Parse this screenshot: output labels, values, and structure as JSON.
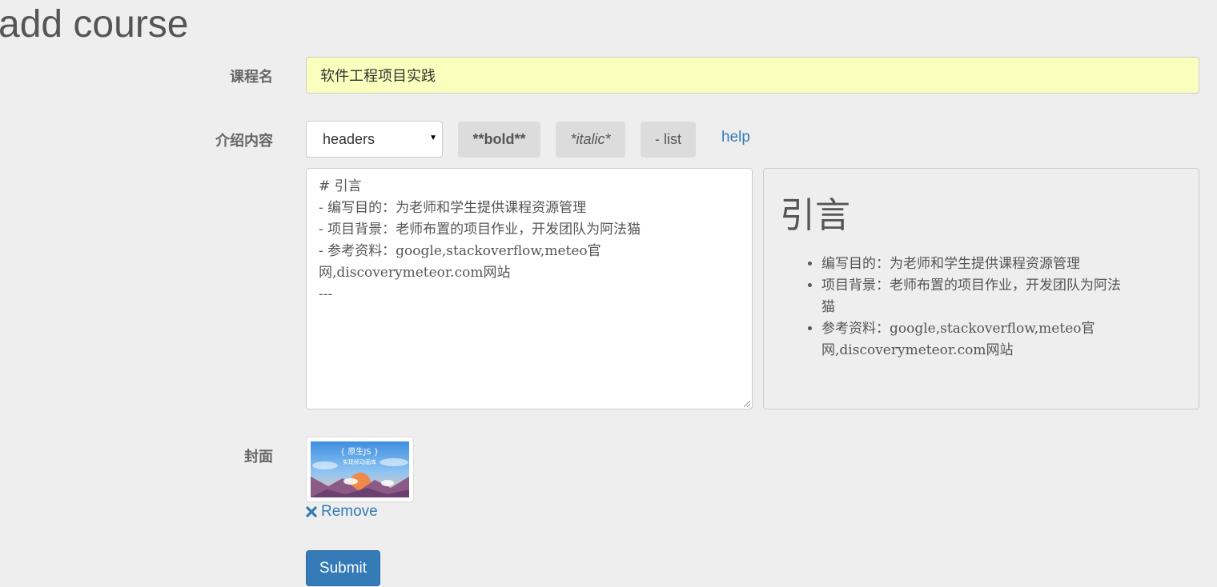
{
  "page": {
    "title": "add course"
  },
  "form": {
    "name_label": "课程名",
    "name_value": "软件工程项目实践",
    "intro_label": "介绍内容",
    "cover_label": "封面"
  },
  "toolbar": {
    "select_value": "headers",
    "bold_label": "**bold**",
    "italic_label": "*italic*",
    "list_label": "- list",
    "help_label": "help"
  },
  "editor": {
    "lines": [
      "# 引言",
      "- 编写目的：为老师和学生提供课程资源管理",
      "- 项目背景：老师布置的项目作业，开发团队为阿法猫",
      "- 参考资料：google,stackoverflow,meteo官",
      "网,discoverymeteor.com网站",
      "---"
    ]
  },
  "preview": {
    "heading": "引言",
    "items": [
      "编写目的：为老师和学生提供课程资源管理",
      "项目背景：老师布置的项目作业，开发团队为阿法猫",
      "参考资料：google,stackoverflow,meteo官网,discoverymeteor.com网站"
    ]
  },
  "cover": {
    "thumb_title": "{ 原生JS }",
    "thumb_subtitle": "实现帧动画库",
    "remove_label": "Remove",
    "remove_icon": "close-icon"
  },
  "actions": {
    "submit_label": "Submit"
  },
  "colors": {
    "background": "#eeeeee",
    "link": "#337ab7",
    "primary": "#337ab7",
    "autofill": "#faffbd"
  }
}
